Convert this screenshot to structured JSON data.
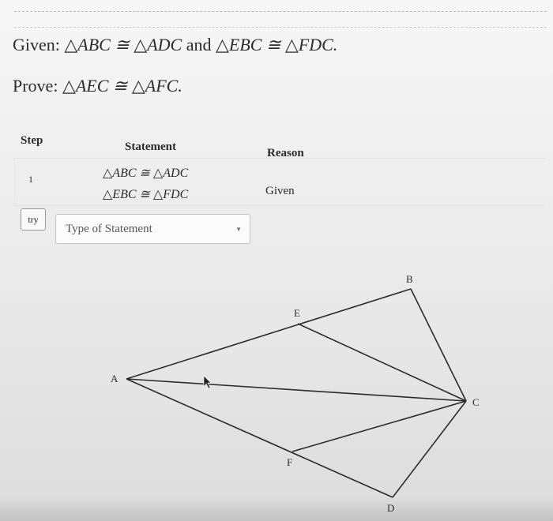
{
  "problem": {
    "given_label": "Given:",
    "given_t1": "△ABC ≅ △ADC",
    "given_and": "and",
    "given_t2": "△EBC ≅ △FDC.",
    "prove_label": "Prove:",
    "prove_statement": "△AEC ≅ △AFC."
  },
  "table": {
    "headers": {
      "step": "Step",
      "statement": "Statement",
      "reason": "Reason"
    },
    "rows": [
      {
        "step": "1",
        "statement_line1": "△ABC ≅ △ADC",
        "statement_line2": "△EBC ≅ △FDC",
        "reason": "Given"
      }
    ]
  },
  "input_row": {
    "try_label": "try",
    "statement_placeholder": "Type of Statement"
  },
  "diagram": {
    "points": {
      "A": "A",
      "B": "B",
      "C": "C",
      "D": "D",
      "E": "E",
      "F": "F"
    }
  },
  "colors": {
    "background": "#eeeeee",
    "line": "#2b2b2b"
  },
  "icons": [
    "chevron-down-icon",
    "cursor-icon"
  ]
}
